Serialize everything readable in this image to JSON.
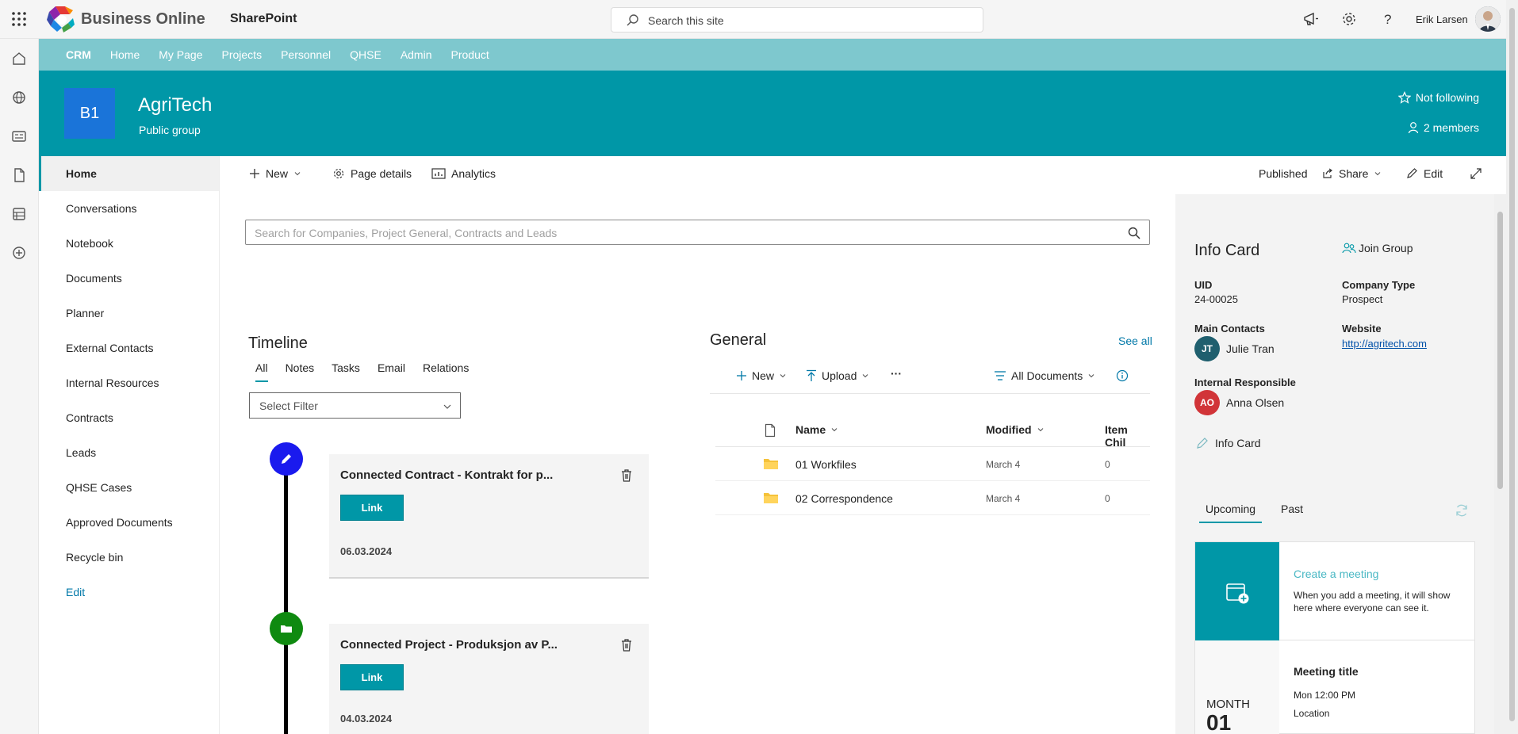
{
  "suite": {
    "brand": "Business Online",
    "app": "SharePoint",
    "search_placeholder": "Search this site",
    "user": "Erik Larsen"
  },
  "hubnav": [
    "CRM",
    "Home",
    "My Page",
    "Projects",
    "Personnel",
    "QHSE",
    "Admin",
    "Product"
  ],
  "site": {
    "logo": "B1",
    "title": "AgriTech",
    "subtitle": "Public group",
    "follow": "Not following",
    "members": "2 members"
  },
  "sitenav": [
    "Home",
    "Conversations",
    "Notebook",
    "Documents",
    "Planner",
    "External Contacts",
    "Internal Resources",
    "Contracts",
    "Leads",
    "QHSE Cases",
    "Approved Documents",
    "Recycle bin",
    "Edit"
  ],
  "cmdbar": {
    "new": "New",
    "page_details": "Page details",
    "analytics": "Analytics",
    "status": "Published",
    "share": "Share",
    "edit": "Edit"
  },
  "search": {
    "placeholder": "Search for Companies, Project General, Contracts and Leads"
  },
  "timeline": {
    "title": "Timeline",
    "tabs": [
      "All",
      "Notes",
      "Tasks",
      "Email",
      "Relations"
    ],
    "filter": "Select Filter",
    "items": [
      {
        "title": "Connected Contract - Kontrakt for p...",
        "button": "Link",
        "date": "06.03.2024",
        "icon": "pencil-icon",
        "color": "#1a1aee"
      },
      {
        "title": "Connected Project - Produksjon av P...",
        "button": "Link",
        "date": "04.03.2024",
        "icon": "folder-icon",
        "color": "#0f8a10"
      }
    ]
  },
  "library": {
    "title": "General",
    "see_all": "See all",
    "cmds": {
      "new": "New",
      "upload": "Upload",
      "more": "···",
      "view": "All Documents"
    },
    "headers": {
      "name": "Name",
      "modified": "Modified",
      "items": "Item Chil"
    },
    "rows": [
      {
        "name": "01 Workfiles",
        "modified": "March 4",
        "items": "0"
      },
      {
        "name": "02 Correspondence",
        "modified": "March 4",
        "items": "0"
      }
    ]
  },
  "infocard": {
    "title": "Info Card",
    "join": "Join Group",
    "uid_label": "UID",
    "uid": "24-00025",
    "company_type_label": "Company Type",
    "company_type": "Prospect",
    "main_contacts_label": "Main Contacts",
    "main_contact": {
      "initials": "JT",
      "name": "Julie Tran",
      "color": "#1f5f6e"
    },
    "website_label": "Website",
    "website": "http://agritech.com",
    "internal_label": "Internal Responsible",
    "internal": {
      "initials": "AO",
      "name": "Anna Olsen",
      "color": "#d13438"
    },
    "edit_link": "Info Card"
  },
  "events": {
    "tabs": [
      "Upcoming",
      "Past"
    ],
    "create_title": "Create a meeting",
    "create_desc": "When you add a meeting, it will show here where everyone can see it.",
    "month": "MONTH",
    "day": "01",
    "meeting_title": "Meeting title",
    "meeting_time": "Mon 12:00 PM",
    "meeting_location": "Location"
  },
  "colors": {
    "accent": "#0097a7",
    "hub": "#7ec8ce",
    "logo": "#1a74d9"
  }
}
